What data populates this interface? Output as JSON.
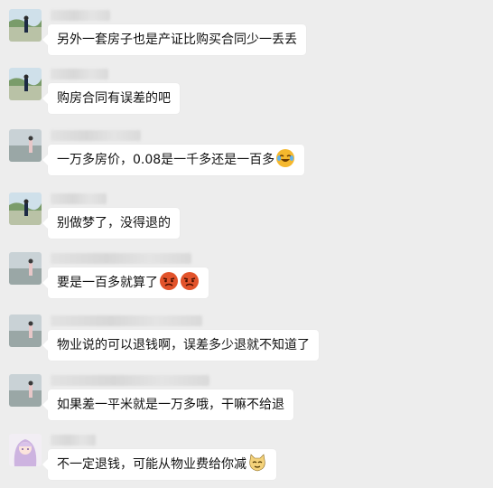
{
  "messages": [
    {
      "text": "另外一套房子也是产证比购买合同少一丢丢",
      "emojis": []
    },
    {
      "text": "购房合同有误差的吧",
      "emojis": []
    },
    {
      "text": "一万多房价，0.08是一千多还是一百多",
      "emojis": [
        "laughing-crying-emoji"
      ]
    },
    {
      "text": "别做梦了，没得退的",
      "emojis": []
    },
    {
      "text": "要是一百多就算了",
      "emojis": [
        "angry-face-emoji",
        "angry-face-emoji"
      ]
    },
    {
      "text": "物业说的可以退钱啊，误差多少退就不知道了",
      "emojis": []
    },
    {
      "text": "如果差一平米就是一万多哦，干嘛不给退",
      "emojis": []
    },
    {
      "text": "不一定退钱，可能从物业费给你减",
      "emojis": [
        "cat-emoji"
      ]
    }
  ]
}
